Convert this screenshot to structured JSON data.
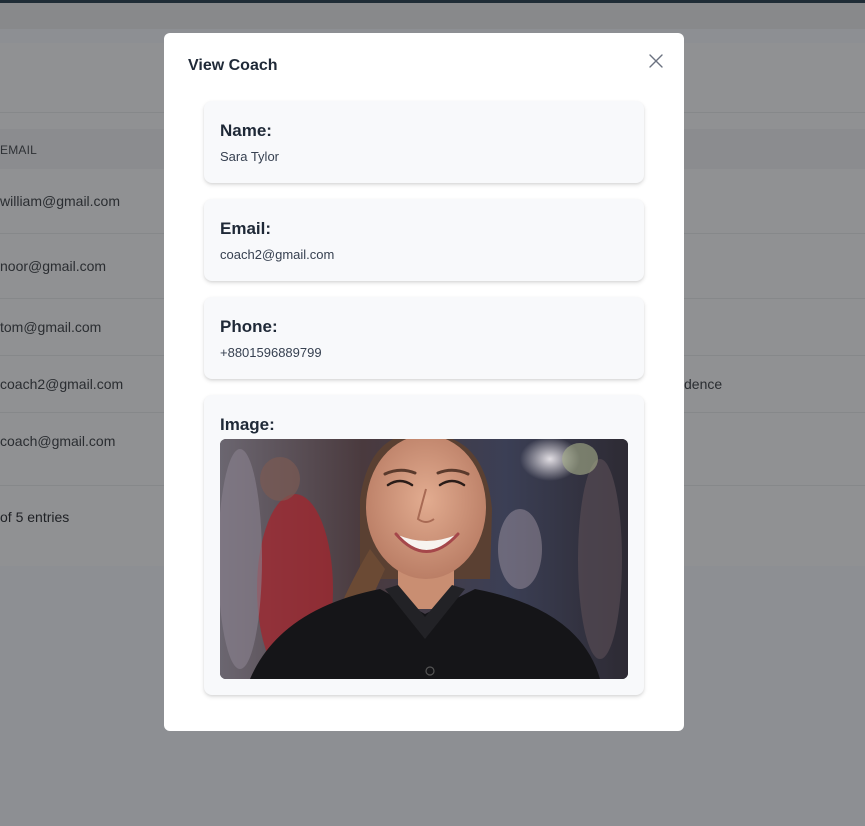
{
  "background": {
    "table_header_email": "EMAIL",
    "rows": [
      {
        "email": "william@gmail.com",
        "extra": ""
      },
      {
        "email": "noor@gmail.com",
        "extra": ""
      },
      {
        "email": "tom@gmail.com",
        "extra": ""
      },
      {
        "email": "coach2@gmail.com",
        "extra": "dence"
      },
      {
        "email": "coach@gmail.com",
        "extra": ""
      }
    ],
    "entries_text": "of 5 entries"
  },
  "modal": {
    "title": "View Coach",
    "name_label": "Name:",
    "name_value": "Sara Tylor",
    "email_label": "Email:",
    "email_value": "coach2@gmail.com",
    "phone_label": "Phone:",
    "phone_value": "+8801596889799",
    "image_label": "Image:"
  }
}
